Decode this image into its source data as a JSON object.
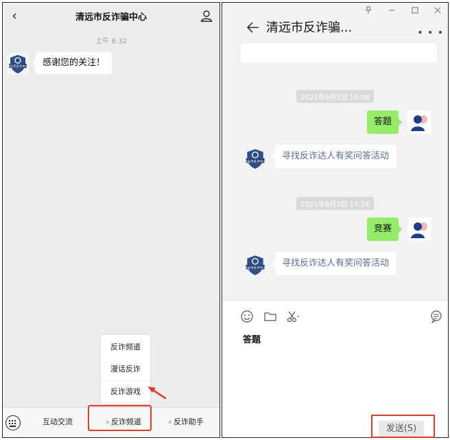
{
  "left": {
    "back_icon": "chevron-left-icon",
    "title": "清远市反诈骗中心",
    "user_icon": "user-icon",
    "time": "上午 8:32",
    "welcome_message": "感谢您的关注！",
    "avatar_icon": "qingyuan-antifraud-logo-icon",
    "popup_menu": [
      "反诈频道",
      "漫话反诈",
      "反诈游戏"
    ],
    "bottom_menu": [
      "互动交流",
      "反诈频道",
      "反诈助手"
    ],
    "keyboard_icon": "keyboard-icon",
    "highlight_color": "#e33a2a"
  },
  "right": {
    "window_controls": [
      "pin-icon",
      "minimize-icon",
      "maximize-icon",
      "close-icon"
    ],
    "title": "清远市反诈骗...",
    "more_icon": "more-icon",
    "messages": [
      {
        "timestamp": "2021年9月2日 16:08",
        "sent": "答题",
        "reply": "寻找反诈达人有奖问答活动"
      },
      {
        "timestamp": "2021年9月2日 17:26",
        "sent": "竞赛",
        "reply": "寻找反诈达人有奖问答活动"
      }
    ],
    "toolbar": [
      "emoji-icon",
      "folder-icon",
      "scissors-icon",
      "chat-history-icon"
    ],
    "input_text": "答题",
    "send_label": "发送(S)",
    "bubble_color": "#95ec69",
    "link_color": "#576b95"
  }
}
